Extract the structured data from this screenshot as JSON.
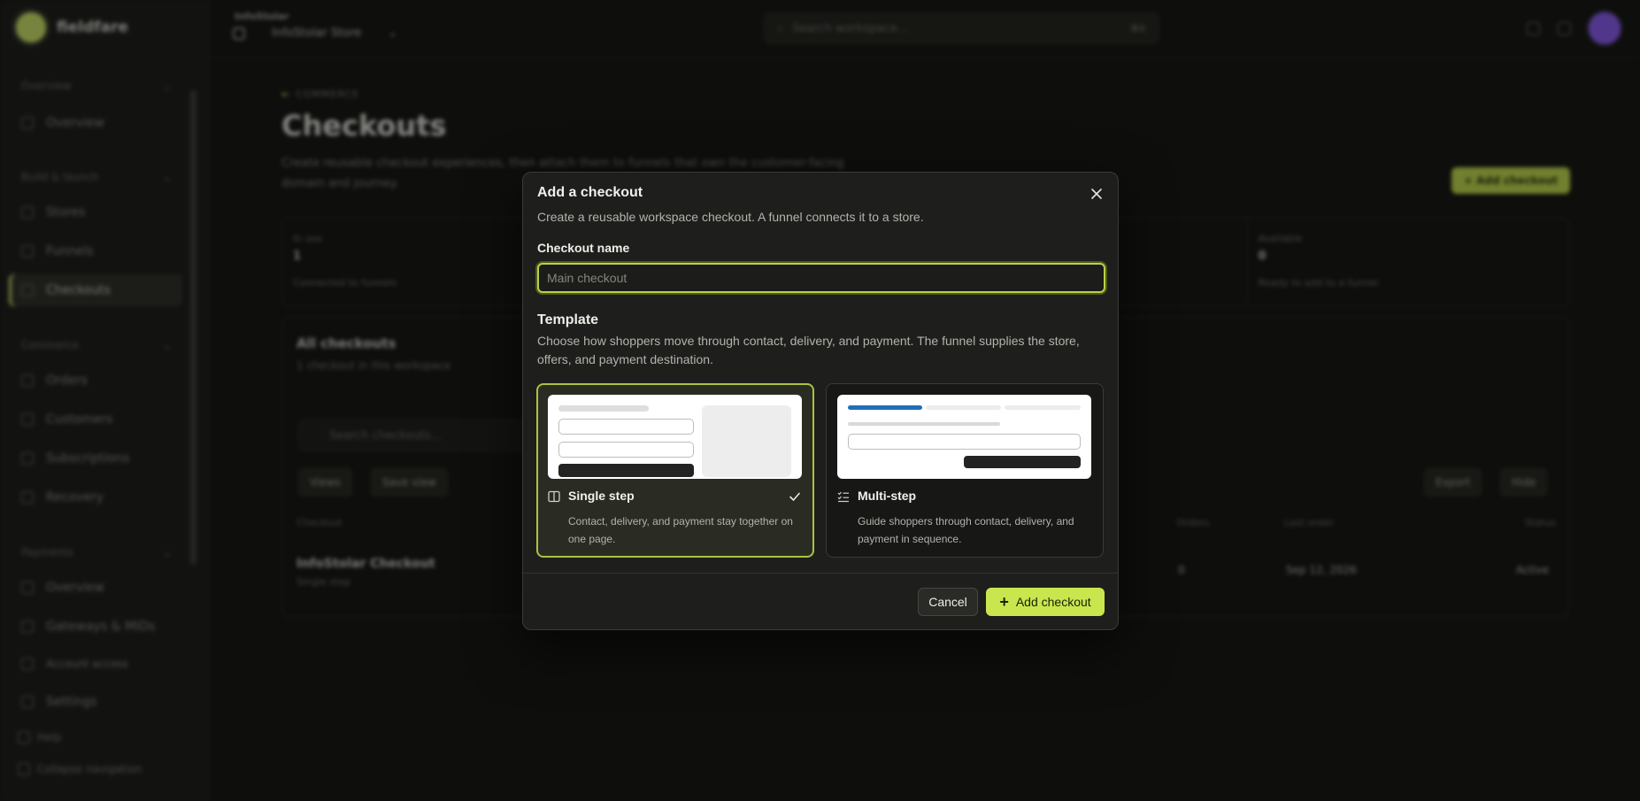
{
  "background": {
    "brand": {
      "name": "fieldfare"
    },
    "workspace": {
      "label": "InfoStolar",
      "name": "InfoStolar Store"
    },
    "search": {
      "placeholder": "Search workspace...",
      "shortcut": "⌘K"
    },
    "sidebar": {
      "sections": [
        {
          "label": "Overview",
          "items": [
            "Overview"
          ]
        },
        {
          "label": "Build & launch",
          "items": [
            "Stores",
            "Funnels",
            "Checkouts"
          ]
        },
        {
          "label": "Commerce",
          "items": [
            "Orders",
            "Customers",
            "Subscriptions",
            "Recovery"
          ]
        },
        {
          "label": "Payments",
          "items": [
            "Overview",
            "Gateways & MIDs",
            "Account access",
            "Settings"
          ]
        }
      ],
      "active_item": "Checkouts",
      "footer": [
        "Help",
        "Collapse navigation"
      ]
    },
    "page": {
      "breadcrumb": "COMMERCE",
      "title": "Checkouts",
      "description": "Create reusable checkout experiences, then attach them to funnels that own the customer-facing domain and journey.",
      "add_button": "Add checkout",
      "stats": [
        {
          "label": "In use",
          "value": "1",
          "note": "Connected to funnels"
        },
        {
          "label": "",
          "value": "",
          "note": ""
        },
        {
          "label": "",
          "value": "",
          "note": ""
        },
        {
          "label": "Available",
          "value": "0",
          "note": "Ready to add to a funnel"
        }
      ],
      "list": {
        "title": "All checkouts",
        "subtitle": "1 checkout in this workspace",
        "search_placeholder": "Search checkouts...",
        "chips": [
          "Views",
          "Save view",
          "Export",
          "Hide"
        ],
        "columns": [
          "Checkout",
          "Orders",
          "Last order",
          "Status"
        ],
        "rows": [
          {
            "name": "InfoStolar Checkout",
            "type": "Single step",
            "orders": "0",
            "last_order": "Sep 12, 2026",
            "status": "Active"
          }
        ]
      }
    }
  },
  "modal": {
    "title": "Add a checkout",
    "description": "Create a reusable workspace checkout. A funnel connects it to a store.",
    "name_label": "Checkout name",
    "name_value": "",
    "name_placeholder": "Main checkout",
    "template_title": "Template",
    "template_description": "Choose how shoppers move through contact, delivery, and payment. The funnel supplies the store, offers, and payment destination.",
    "templates": [
      {
        "label": "Single step",
        "description": "Contact, delivery, and payment stay together on one page.",
        "icon": "columns-icon",
        "selected": true
      },
      {
        "label": "Multi-step",
        "description": "Guide shoppers through contact, delivery, and payment in sequence.",
        "icon": "list-checks-icon",
        "selected": false
      }
    ],
    "cancel_label": "Cancel",
    "submit_label": "Add checkout"
  },
  "colors": {
    "accent": "#c9e64f",
    "progress": "#1f6fb8",
    "surface": "#1e1f1c"
  }
}
